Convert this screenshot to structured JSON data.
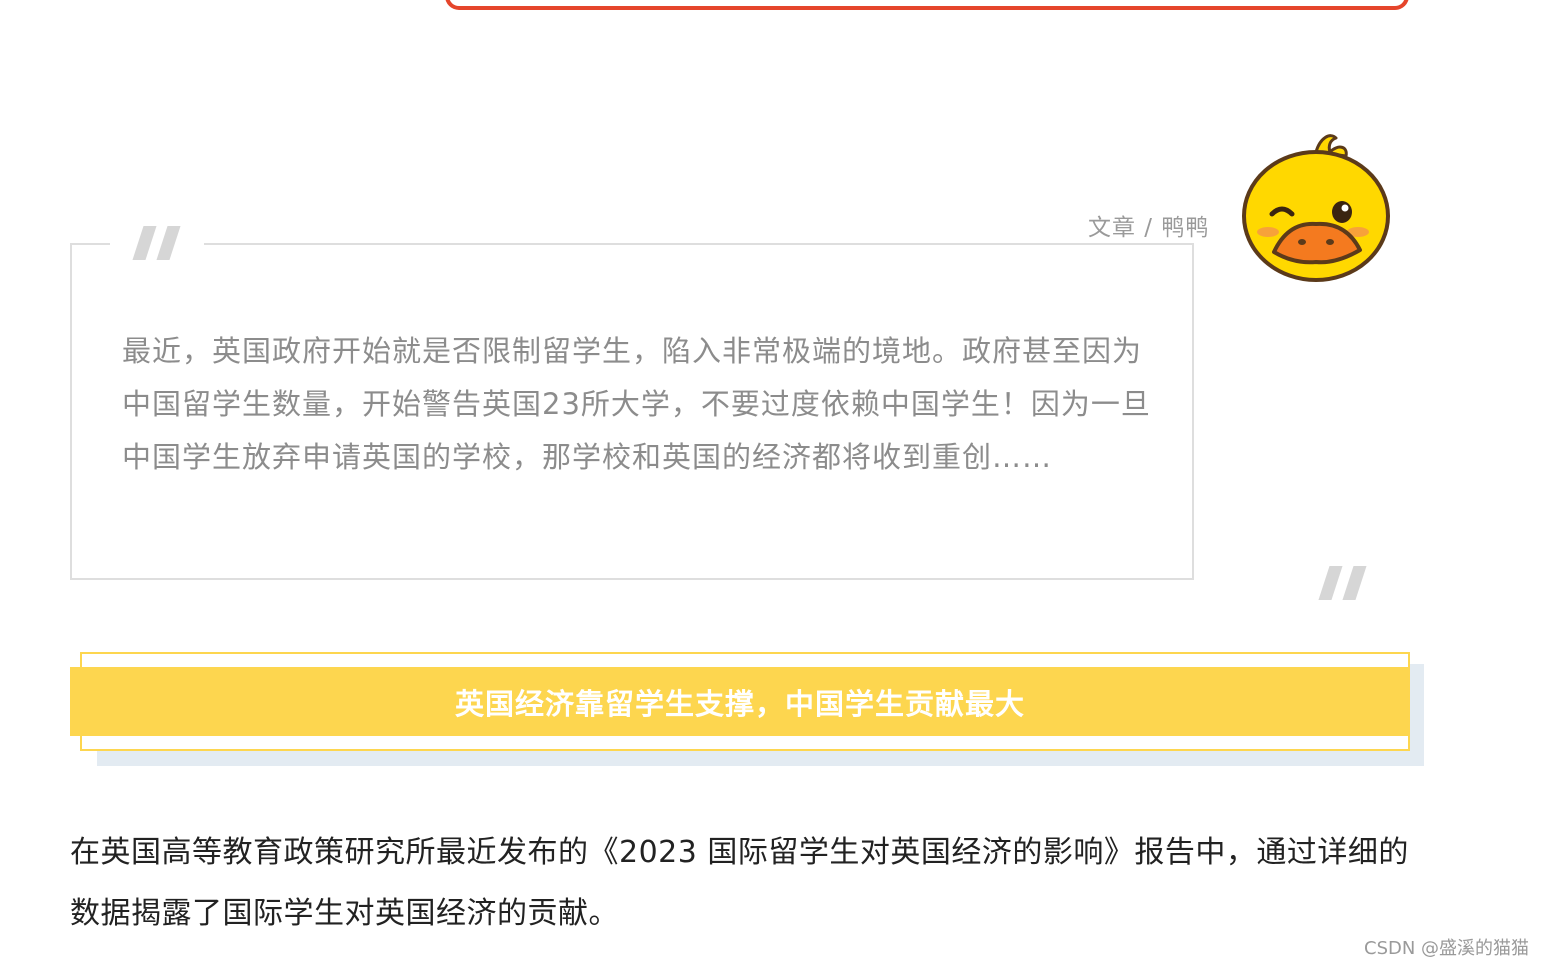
{
  "byline": "文章 / 鸭鸭",
  "quote": "最近，英国政府开始就是否限制留学生，陷入非常极端的境地。政府甚至因为中国留学生数量，开始警告英国23所大学，不要过度依赖中国学生！因为一旦中国学生放弃申请英国的学校，那学校和英国的经济都将收到重创……",
  "section_heading": "英国经济靠留学生支撑，中国学生贡献最大",
  "body_paragraph": "在英国高等教育政策研究所最近发布的《2023 国际留学生对英国经济的影响》报告中，通过详细的数据揭露了国际学生对英国经济的贡献。",
  "watermark": "CSDN @盛溪的猫猫",
  "colors": {
    "accent_red": "#e5452b",
    "banner_yellow": "#fdd64f",
    "quote_text": "#8c8c8c",
    "banner_shadow": "#e3ebf2"
  },
  "icons": {
    "duck": "yellow-duck-avatar-icon",
    "quote_open": "open-quote-icon",
    "quote_close": "close-quote-icon"
  }
}
